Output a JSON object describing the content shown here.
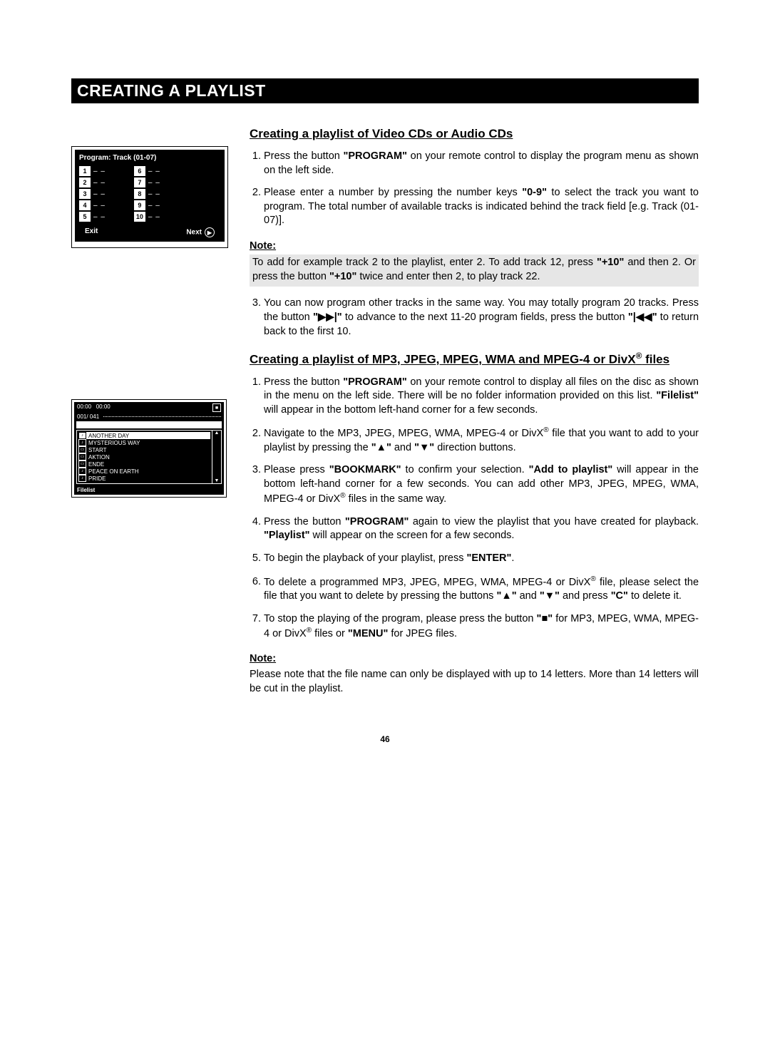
{
  "title": "CREATING A PLAYLIST",
  "page_number": "46",
  "program_menu": {
    "header": "Program: Track (01-07)",
    "left_numbers": [
      "1",
      "2",
      "3",
      "4",
      "5"
    ],
    "right_numbers": [
      "6",
      "7",
      "8",
      "9",
      "10"
    ],
    "dash": "– –",
    "exit": "Exit",
    "next": "Next"
  },
  "filelist_menu": {
    "time1": "00:00",
    "time2": "00:00",
    "counter": "001/ 041",
    "items": [
      "ANOTHER DAY",
      "MYSTERIOUS WAY",
      "START",
      "AKTION",
      "ENDE",
      "PEACE ON EARTH",
      "PRIDE"
    ],
    "footer": "Filelist",
    "up": "▲",
    "down": "▼",
    "stop": "■"
  },
  "section1": {
    "heading": "Creating a playlist of Video CDs or Audio CDs",
    "step1a": "Press the button ",
    "step1b": "\"PROGRAM\"",
    "step1c": " on your remote control to display the program menu as shown on the left side.",
    "step2a": "Please enter a number by pressing the number keys ",
    "step2b": "\"0-9\"",
    "step2c": " to select the track you want to program. The total number of available tracks is indicated behind the track field [e.g. Track (01-07)].",
    "note_label": "Note:",
    "note_a": "To add for example track 2 to the playlist, enter 2. To add track 12, press ",
    "note_b": "\"+10\"",
    "note_c": " and then 2. Or press the button ",
    "note_d": "\"+10\"",
    "note_e": " twice and enter then 2, to play track 22.",
    "step3a": "You can now program other tracks in the same way. You may totally program 20 tracks. Press the button ",
    "step3b": "\"▶▶|\"",
    "step3c": " to advance to the next 11-20 program fields, press the button ",
    "step3d": "\"|◀◀\"",
    "step3e": " to return back to the first 10."
  },
  "section2": {
    "heading_a": "Creating a playlist of MP3, JPEG, MPEG, WMA and MPEG-4 or DivX",
    "heading_b": " files",
    "step1a": "Press the button ",
    "step1b": "\"PROGRAM\"",
    "step1c": " on your remote control to display all files on the disc as shown in the menu on the left side. There will be no folder information provided on this list. ",
    "step1d": "\"Filelist\"",
    "step1e": " will appear in the bottom left-hand corner for a few seconds.",
    "step2a": "Navigate to the MP3, JPEG, MPEG, WMA, MPEG-4 or DivX",
    "step2b": " file that you want to add to your playlist by pressing the ",
    "step2c": "\"▲\"",
    "step2d": " and ",
    "step2e": "\"▼\"",
    "step2f": " direction buttons.",
    "step3a": "Please press ",
    "step3b": "\"BOOKMARK\"",
    "step3c": " to confirm your selection. ",
    "step3d": "\"Add to playlist\"",
    "step3e": " will appear in the bottom left-hand corner for a few seconds. You can add other MP3, JPEG, MPEG, WMA, MPEG-4 or DivX",
    "step3f": " files in the same way.",
    "step4a": "Press the button ",
    "step4b": "\"PROGRAM\"",
    "step4c": " again to view the playlist that you have created for playback. ",
    "step4d": "\"Playlist\"",
    "step4e": " will appear on the screen for a few seconds.",
    "step5a": "To begin the playback of your playlist, press ",
    "step5b": "\"ENTER\"",
    "step5c": ".",
    "step6a": "To delete a programmed MP3, JPEG, MPEG, WMA, MPEG-4 or DivX",
    "step6b": " file, please select the file that you want to delete by pressing the buttons ",
    "step6c": "\"▲\"",
    "step6d": " and ",
    "step6e": "\"▼\"",
    "step6f": " and press ",
    "step6g": "\"C\"",
    "step6h": " to delete it.",
    "step7a": "To stop the playing of the program, please press the button ",
    "step7b": "\"■\"",
    "step7c": " for MP3, MPEG, WMA, MPEG-4 or DivX",
    "step7d": " files or ",
    "step7e": "\"MENU\"",
    "step7f": " for JPEG files.",
    "note_label": "Note:",
    "note_text": "Please note that the file name can only be displayed with up to 14 letters. More than 14 letters will be cut in the playlist."
  },
  "reg": "®"
}
